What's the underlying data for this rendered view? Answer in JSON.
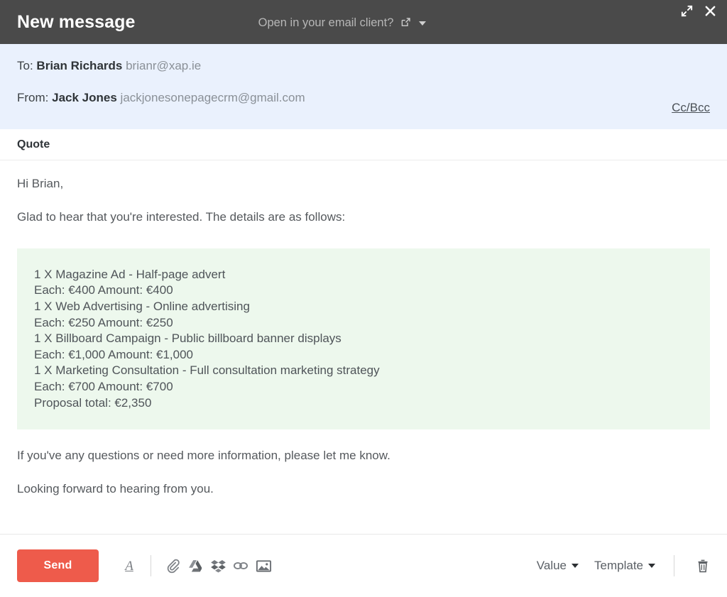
{
  "header": {
    "title": "New message",
    "open_in_client_label": "Open in your email client?",
    "external_link_icon": "external-link-icon",
    "caret_icon": "chevron-down-icon",
    "expand_icon": "expand-icon",
    "close_icon": "close-icon"
  },
  "address": {
    "to_label": "To:",
    "to_name": "Brian Richards",
    "to_email": "brianr@xap.ie",
    "from_label": "From:",
    "from_name": "Jack Jones",
    "from_email": "jackjonesonepagecrm@gmail.com",
    "ccbcc_label": "Cc/Bcc"
  },
  "subject": {
    "value": "Quote"
  },
  "body": {
    "greeting": "Hi Brian,",
    "intro": "Glad to hear that you're interested. The details are as follows:",
    "quote_lines": [
      "1 X Magazine Ad - Half-page advert",
      "Each: €400 Amount: €400",
      "1 X Web Advertising - Online advertising",
      "Each: €250 Amount: €250",
      "1 X Billboard Campaign - Public billboard banner displays",
      "Each: €1,000 Amount: €1,000",
      "1 X Marketing Consultation - Full consultation marketing strategy",
      "Each: €700 Amount: €700",
      "Proposal total: €2,350"
    ],
    "closing_1": "If you've any questions or need more information, please let me know.",
    "closing_2": "Looking forward to hearing from you."
  },
  "toolbar": {
    "send_label": "Send",
    "format_icon_label": "A",
    "icons": [
      "text-format-icon",
      "attachment-icon",
      "google-drive-icon",
      "dropbox-icon",
      "link-icon",
      "image-icon"
    ],
    "value_label": "Value",
    "template_label": "Template",
    "trash_icon": "trash-icon"
  },
  "colors": {
    "header_bg": "#4a4a4a",
    "address_bg": "#eaf1fd",
    "quote_bg": "#edf8ed",
    "send_btn": "#ee5b4b",
    "body_text": "#55595d"
  }
}
